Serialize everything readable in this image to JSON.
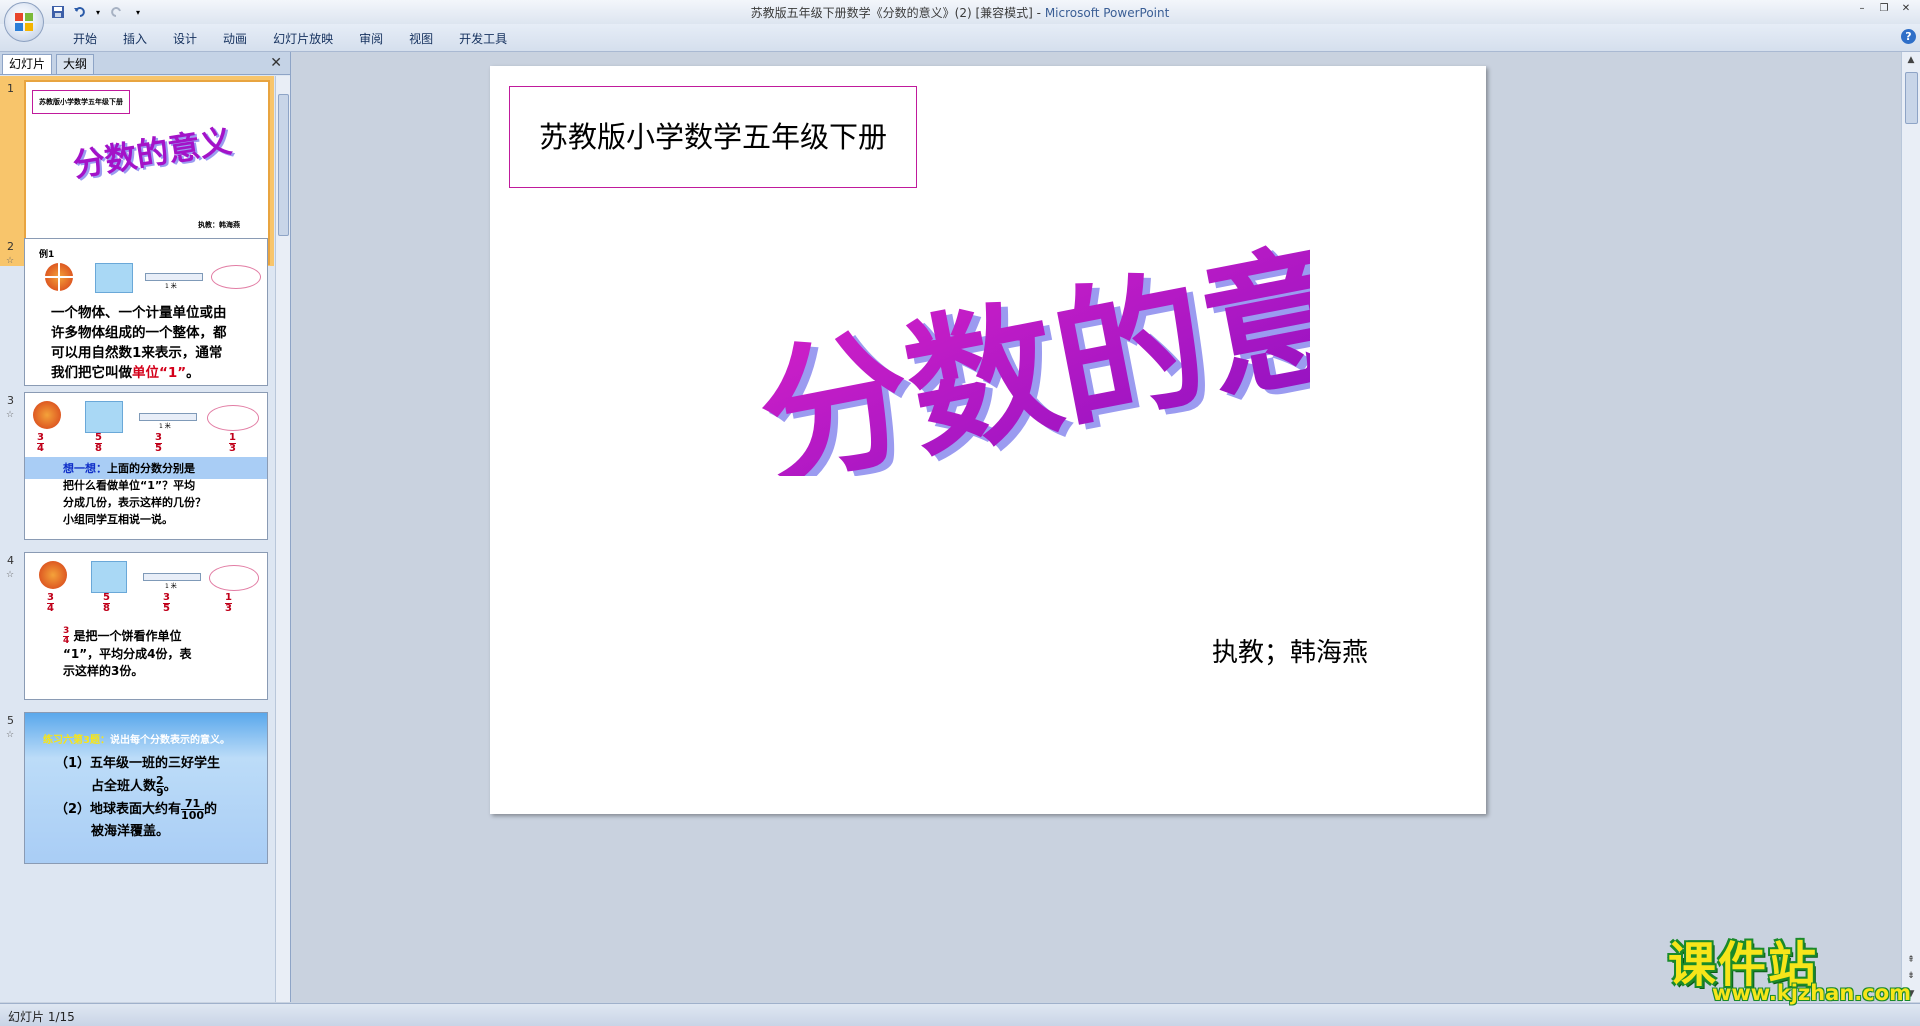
{
  "window": {
    "title": "苏教版五年级下册数学《分数的意义》(2) [兼容模式] - ",
    "app_name": "Microsoft PowerPoint"
  },
  "ribbon": {
    "tabs": [
      "开始",
      "插入",
      "设计",
      "动画",
      "幻灯片放映",
      "审阅",
      "视图",
      "开发工具"
    ]
  },
  "left_pane": {
    "tab_slides": "幻灯片",
    "tab_outline": "大纲"
  },
  "thumbnails": [
    {
      "num": "1",
      "title_box": "苏教版小学数学五年级下册",
      "big_title": "分数的意义",
      "author": "执教：韩海燕"
    },
    {
      "num": "2",
      "label": "例1",
      "ruler_label": "1 米",
      "line1": "一个物体、一个计量单位或由",
      "line2": "许多物体组成的一个整体，都",
      "line3": "可以用自然数1来表示，通常",
      "line4_prefix": "我们把它叫做",
      "line4_red": "单位“1”",
      "line4_end": "。"
    },
    {
      "num": "3",
      "ruler_label": "1 米",
      "fractions": [
        [
          "3",
          "4"
        ],
        [
          "5",
          "8"
        ],
        [
          "3",
          "5"
        ],
        [
          "1",
          "3"
        ]
      ],
      "think_label": "想一想：",
      "text1": "上面的分数分别是",
      "text2": "把什么看做单位“1”？平均",
      "text3": "分成几份，表示这样的几份？",
      "text4": "小组同学互相说一说。"
    },
    {
      "num": "4",
      "ruler_label": "1 米",
      "fractions": [
        [
          "3",
          "4"
        ],
        [
          "5",
          "8"
        ],
        [
          "3",
          "5"
        ],
        [
          "1",
          "3"
        ]
      ],
      "frac_num": "3",
      "frac_den": "4",
      "text1": "是把一个饼看作单位",
      "text2": "“1”，平均分成4份，表",
      "text3": "示这样的3份。"
    },
    {
      "num": "5",
      "header_label": "练习六第3题：",
      "header_text": "说出每个分数表示的意义。",
      "item1a": "（1）五年级一班的三好学生",
      "item1b": "占全班人数",
      "item1_num": "2",
      "item1_den": "9",
      "item2a": "（2）地球表面大约有",
      "item2_num": "71",
      "item2_den": "100",
      "item2b": "的",
      "item2c": "被海洋覆盖。"
    }
  ],
  "slide": {
    "title_box": "苏教版小学数学五年级下册",
    "big_title": "分数的意义",
    "teacher": "执教；韩海燕"
  },
  "status": {
    "text": "幻灯片 1/15"
  },
  "watermark": {
    "logo": "课件站",
    "url": "www.kjzhan.com"
  },
  "colors": {
    "title_purple": "#a412c8",
    "title_shadow": "#9b9bf0",
    "box_border": "#c01a9c",
    "selected_thumb": "#f8c56b",
    "watermark_yellow": "#f7e51a",
    "watermark_green": "#1a8a2a"
  }
}
